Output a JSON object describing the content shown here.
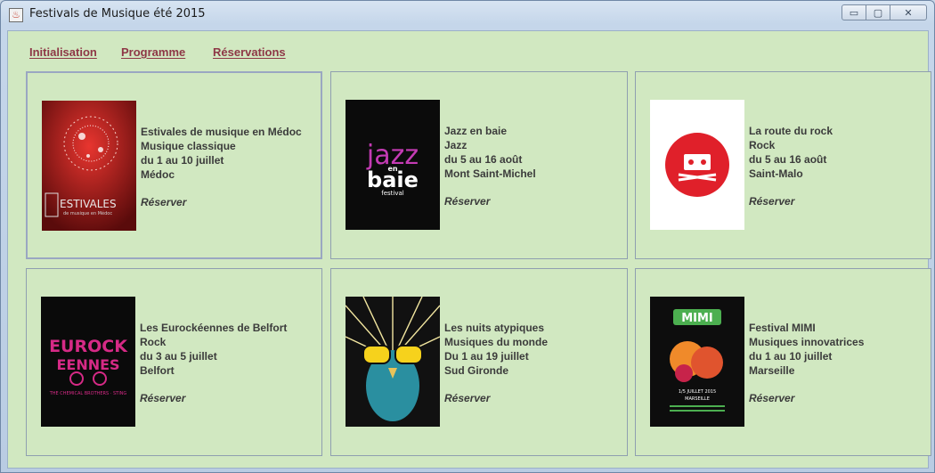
{
  "window": {
    "title": "Festivals de Musique été 2015",
    "buttons": {
      "minimize": "▭",
      "maximize": "▢",
      "close": "✕"
    }
  },
  "menu": {
    "items": [
      {
        "label": "Initialisation"
      },
      {
        "label": "Programme"
      },
      {
        "label": "Réservations"
      }
    ]
  },
  "festivals": [
    {
      "name": "Estivales de musique en Médoc",
      "genre": "Musique classique",
      "dates": "du 1 au 10 juillet",
      "place": "Médoc",
      "action": "Réserver",
      "poster_text": "ESTIVALES",
      "poster_sub": "de musique en Médoc"
    },
    {
      "name": "Jazz en baie",
      "genre": "Jazz",
      "dates": "du 5 au 16 août",
      "place": "Mont Saint-Michel",
      "action": "Réserver",
      "poster_text": "jazz",
      "poster_en": "en",
      "poster_baie": "baie",
      "poster_festival": "festival"
    },
    {
      "name": "La route du rock",
      "genre": "Rock",
      "dates": "du 5 au 16 août",
      "place": "Saint-Malo",
      "action": "Réserver"
    },
    {
      "name": "Les Eurockéennes de Belfort",
      "genre": "Rock",
      "dates": "du 3 au 5 juillet",
      "place": "Belfort",
      "action": "Réserver",
      "poster_text": "EUROCK",
      "poster_text2": "EENNES",
      "poster_sub": "THE CHEMICAL BROTHERS · STING"
    },
    {
      "name": "Les nuits atypiques",
      "genre": "Musiques du monde",
      "dates": "Du 1 au 19 juillet",
      "place": "Sud Gironde",
      "action": "Réserver"
    },
    {
      "name": "Festival MIMI",
      "genre": "Musiques innovatrices",
      "dates": "du 1 au 10 juillet",
      "place": "Marseille",
      "action": "Réserver",
      "poster_text": "MIMI",
      "poster_sub": "1/5 JUILLET 2015",
      "poster_city": "MARSEILLE"
    }
  ],
  "colors": {
    "panel_bg": "#d1e8c1",
    "menu_text": "#8e3746",
    "card_text": "#3b3b3b"
  }
}
